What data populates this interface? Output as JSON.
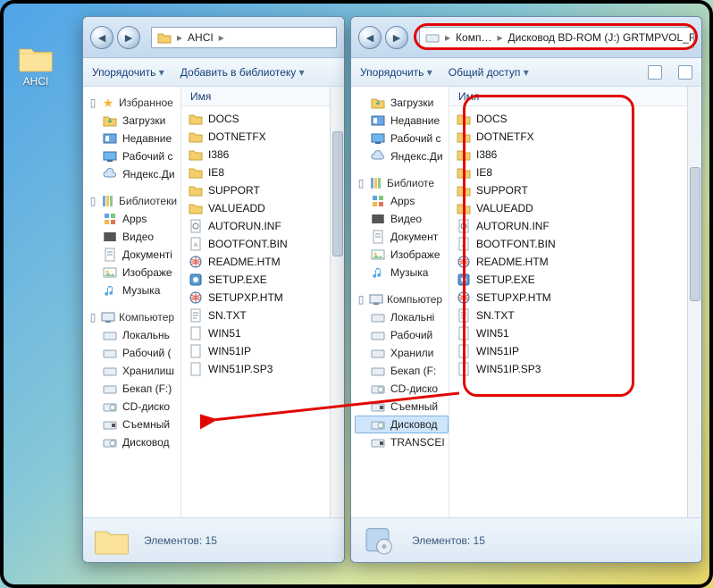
{
  "desktop": {
    "icon_label": "AHCI"
  },
  "windows": {
    "left": {
      "address_parts": [
        "AHCI"
      ],
      "toolbar": {
        "organize": "Упорядочить",
        "addlib": "Добавить в библиотеку"
      },
      "col_name": "Имя",
      "nav": {
        "fav": {
          "label": "Избранное",
          "items": [
            "Загрузки",
            "Недавние",
            "Рабочий с",
            "Яндекс.Ди"
          ]
        },
        "lib": {
          "label": "Библиотеки",
          "items": [
            "Apps",
            "Видео",
            "Документі",
            "Изображе",
            "Музыка"
          ]
        },
        "comp": {
          "label": "Компьютер",
          "items": [
            "Локальнь",
            "Рабочий (",
            "Хранилиш",
            "Бекап (F:)",
            "CD-диско",
            "Съемный",
            "Дисковод"
          ]
        }
      },
      "files": [
        {
          "t": "folder",
          "n": "DOCS"
        },
        {
          "t": "folder",
          "n": "DOTNETFX"
        },
        {
          "t": "folder",
          "n": "I386"
        },
        {
          "t": "folder",
          "n": "IE8"
        },
        {
          "t": "folder",
          "n": "SUPPORT"
        },
        {
          "t": "folder",
          "n": "VALUEADD"
        },
        {
          "t": "inf",
          "n": "AUTORUN.INF"
        },
        {
          "t": "bin",
          "n": "BOOTFONT.BIN"
        },
        {
          "t": "htm",
          "n": "README.HTM"
        },
        {
          "t": "exe",
          "n": "SETUP.EXE"
        },
        {
          "t": "htm",
          "n": "SETUPXP.HTM"
        },
        {
          "t": "txt",
          "n": "SN.TXT"
        },
        {
          "t": "file",
          "n": "WIN51"
        },
        {
          "t": "file",
          "n": "WIN51IP"
        },
        {
          "t": "file",
          "n": "WIN51IP.SP3"
        }
      ],
      "status": "Элементов: 15"
    },
    "right": {
      "address_parts": [
        "Комп…",
        "Дисковод BD-ROM (J:) GRTMPVOL_RU"
      ],
      "toolbar": {
        "organize": "Упорядочить",
        "share": "Общий доступ"
      },
      "col_name": "Имя",
      "nav": {
        "fav_items": [
          "Загрузки",
          "Недавние",
          "Рабочий с",
          "Яндекс.Ди"
        ],
        "lib": {
          "label": "Библиоте",
          "items": [
            "Apps",
            "Видео",
            "Документ",
            "Изображе",
            "Музыка"
          ]
        },
        "comp": {
          "label": "Компьютер",
          "items": [
            "Локальні",
            "Рабочий",
            "Хранили",
            "Бекап (F:",
            "CD-диско",
            "Съемный",
            "Дисковод",
            "TRANSCEI"
          ]
        },
        "selected_index": 6
      },
      "files": [
        {
          "t": "folder",
          "n": "DOCS"
        },
        {
          "t": "folder",
          "n": "DOTNETFX"
        },
        {
          "t": "folder",
          "n": "I386"
        },
        {
          "t": "folder",
          "n": "IE8"
        },
        {
          "t": "folder",
          "n": "SUPPORT"
        },
        {
          "t": "folder",
          "n": "VALUEADD"
        },
        {
          "t": "inf",
          "n": "AUTORUN.INF"
        },
        {
          "t": "bin",
          "n": "BOOTFONT.BIN"
        },
        {
          "t": "htm",
          "n": "README.HTM"
        },
        {
          "t": "exe",
          "n": "SETUP.EXE"
        },
        {
          "t": "htm",
          "n": "SETUPXP.HTM"
        },
        {
          "t": "txt",
          "n": "SN.TXT"
        },
        {
          "t": "file",
          "n": "WIN51"
        },
        {
          "t": "file",
          "n": "WIN51IP"
        },
        {
          "t": "file",
          "n": "WIN51IP.SP3"
        }
      ],
      "status": "Элементов: 15"
    }
  }
}
